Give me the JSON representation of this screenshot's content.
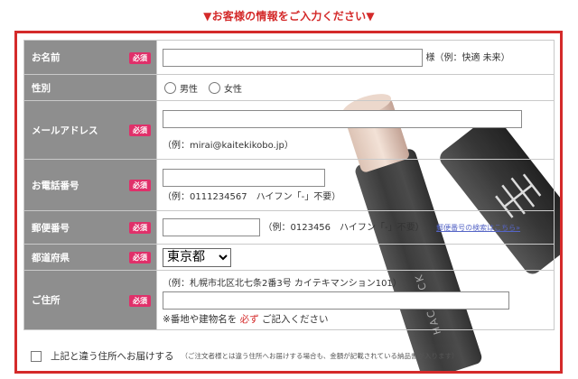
{
  "heading": "▼お客様の情報をご入力ください▼",
  "required_badge": "必須",
  "rows": {
    "name": {
      "label": "お名前",
      "suffix": "様（例：快適 未来）"
    },
    "gender": {
      "label": "性別",
      "options": [
        "男性",
        "女性"
      ]
    },
    "email": {
      "label": "メールアドレス",
      "example": "（例：mirai@kaitekikobo.jp）"
    },
    "phone": {
      "label": "お電話番号",
      "example": "（例：0111234567　ハイフン「-」不要）"
    },
    "postal": {
      "label": "郵便番号",
      "example": "（例：0123456　ハイフン「-」不要）",
      "lookup_link": "郵便番号の検索はこちら»"
    },
    "prefecture": {
      "label": "都道府県",
      "selected": "東京都"
    },
    "address": {
      "label": "ご住所",
      "example": "（例：札幌市北区北七条2番3号 カイテキマンション101）",
      "warning_pre": "※番地や建物名を",
      "warning_emph": "必ず",
      "warning_post": "ご記入ください"
    }
  },
  "different_address": {
    "label": "上記と違う住所へお届けする",
    "note": "（ご注文者様とは違う住所へお届けする場合も、金額が記載されている納品書が入ります）"
  },
  "product_brand_text": "HACKTICK",
  "colors": {
    "accent": "#d42a2a",
    "badge": "#e0306a",
    "label_bg": "#8e8e8e",
    "link": "#5565c6"
  }
}
